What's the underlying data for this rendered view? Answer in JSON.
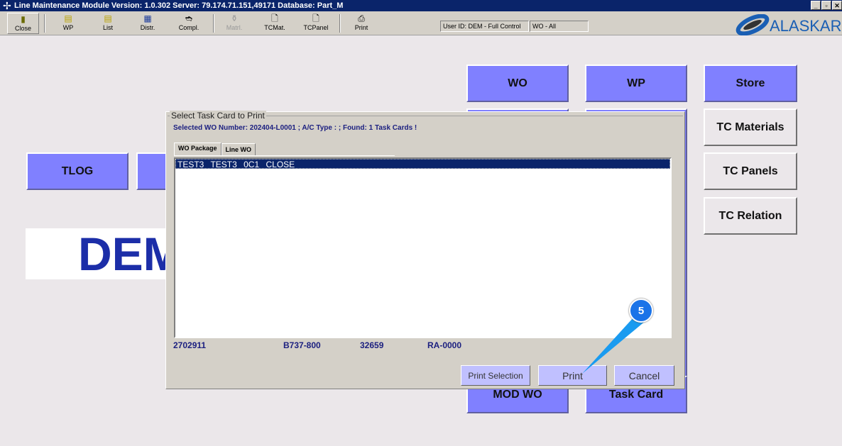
{
  "window": {
    "title": "Line Maintenance Module  Version: 1.0.302 Server: 79.174.71.151,49171 Database: Part_M",
    "controls": [
      "_",
      "▫",
      "✕"
    ]
  },
  "toolbar": {
    "items": [
      {
        "label": "Close",
        "icon": "door-exit-icon"
      },
      {
        "label": "WP",
        "icon": "printer-yellow-icon"
      },
      {
        "label": "List",
        "icon": "printer-yellow-icon"
      },
      {
        "label": "Distr.",
        "icon": "grid-icon"
      },
      {
        "label": "Compl.",
        "icon": "tag-arrow-icon"
      },
      {
        "label": "Matrl.",
        "icon": "flask-icon",
        "disabled": true
      },
      {
        "label": "TCMat.",
        "icon": "document-icon"
      },
      {
        "label": "TCPanel",
        "icon": "document-icon"
      },
      {
        "label": "Print",
        "icon": "printer-icon"
      }
    ],
    "user_status": "User ID: DEM - Full Control",
    "wo_status": "WO - All"
  },
  "logo": {
    "text": "ALASKAR",
    "color": "#1a5fb4"
  },
  "main": {
    "buttons": {
      "wo": "WO",
      "wp": "WP",
      "store": "Store",
      "tc_materials": "TC Materials",
      "tc_panels": "TC Panels",
      "tc_relation": "TC Relation",
      "tlog": "TLOG",
      "mod_wo": "MOD WO",
      "task_card": "Task Card"
    },
    "demo_text": "DEM"
  },
  "dialog": {
    "title": "Select Task Card to Print",
    "info": "Selected WO Number: 202404-L0001 ;  A/C Type : ; Found: 1 Task Cards !",
    "tabs": [
      {
        "label": "WO Package",
        "active": true
      },
      {
        "label": "Line WO",
        "active": false
      }
    ],
    "list": [
      {
        "text": "TEST3  TEST3  0C1  CLOSE",
        "selected": true
      }
    ],
    "footer": [
      "2702911",
      "B737-800",
      "32659",
      "RA-0000"
    ],
    "buttons": {
      "print_selection": "Print Selection",
      "print": "Print",
      "cancel": "Cancel"
    }
  },
  "callout": {
    "step": "5"
  },
  "colors": {
    "accent_button": "#8080ff",
    "titlebar": "#0a246a",
    "callout": "#1a73e8"
  }
}
